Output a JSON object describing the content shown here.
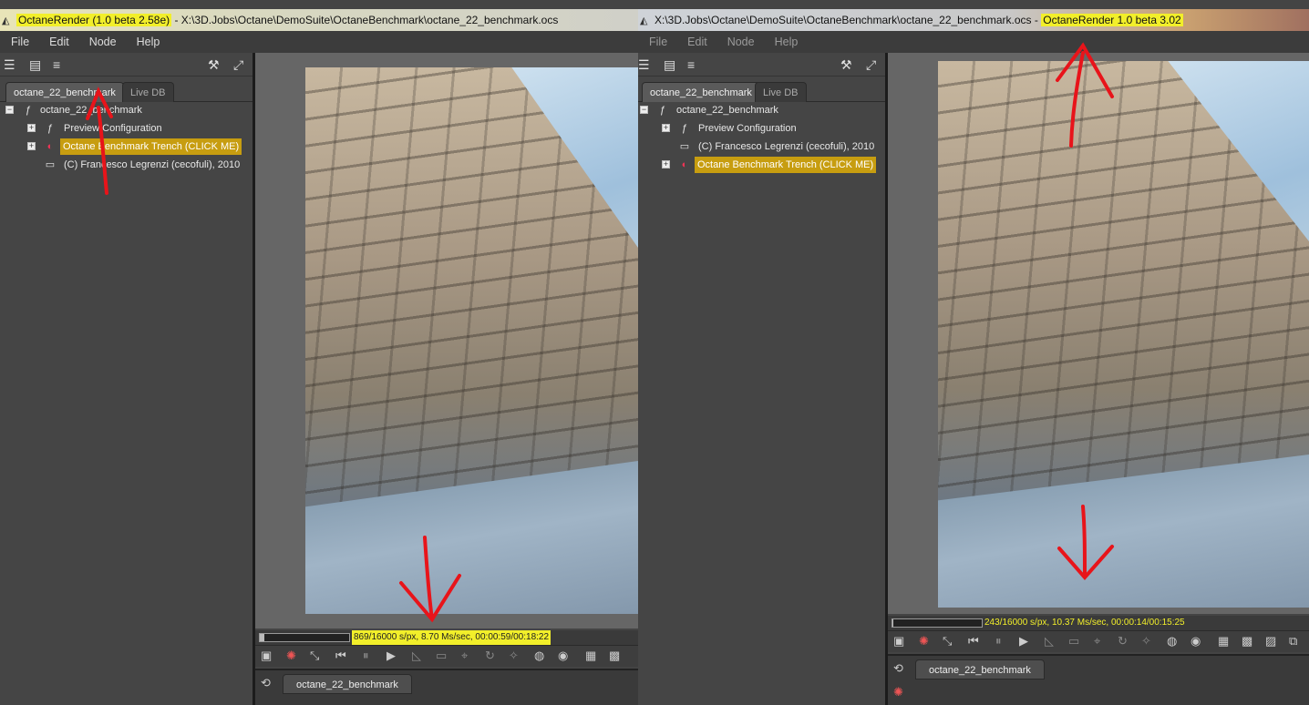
{
  "left": {
    "title_app": "OctaneRender (1.0 beta 2.58e)",
    "title_sep": " - ",
    "title_path": "X:\\3D.Jobs\\Octane\\DemoSuite\\OctaneBenchmark\\octane_22_benchmark.ocs",
    "menu": [
      "File",
      "Edit",
      "Node",
      "Help"
    ],
    "tabs": [
      "octane_22_benchmark",
      "Live DB"
    ],
    "tree": {
      "root": "octane_22_benchmark",
      "items": [
        "Preview Configuration",
        "Octane Benchmark Trench (CLICK ME)",
        "(C) Francesco Legrenzi (cecofuli), 2010"
      ]
    },
    "status_text": "869/16000 s/px, 8.70 Ms/sec, 00:00:59/00:18:22",
    "progress": 0.054,
    "bottom_tab": "octane_22_benchmark"
  },
  "right": {
    "title_path": "X:\\3D.Jobs\\Octane\\DemoSuite\\OctaneBenchmark\\octane_22_benchmark.ocs",
    "title_sep": " - ",
    "title_app": "OctaneRender 1.0 beta 3.02",
    "menu": [
      "File",
      "Edit",
      "Node",
      "Help"
    ],
    "tabs": [
      "octane_22_benchmark",
      "Live DB"
    ],
    "tree": {
      "root": "octane_22_benchmark",
      "items": [
        "Preview Configuration",
        "(C) Francesco Legrenzi (cecofuli), 2010",
        "Octane Benchmark Trench (CLICK ME)"
      ]
    },
    "status_text": "243/16000 s/px, 10.37 Ms/sec, 00:00:14/00:15:25",
    "progress": 0.015,
    "bottom_tab": "octane_22_benchmark"
  },
  "colors": {
    "highlight": "#f2ef2a",
    "selected": "#c79d10",
    "annotation": "#e8141a"
  },
  "icons": [
    "app-icon",
    "scene-icon",
    "material-icon",
    "comment-icon",
    "wrench-icon",
    "fullscreen-icon",
    "play-icon",
    "pause-icon",
    "rewind-icon"
  ]
}
